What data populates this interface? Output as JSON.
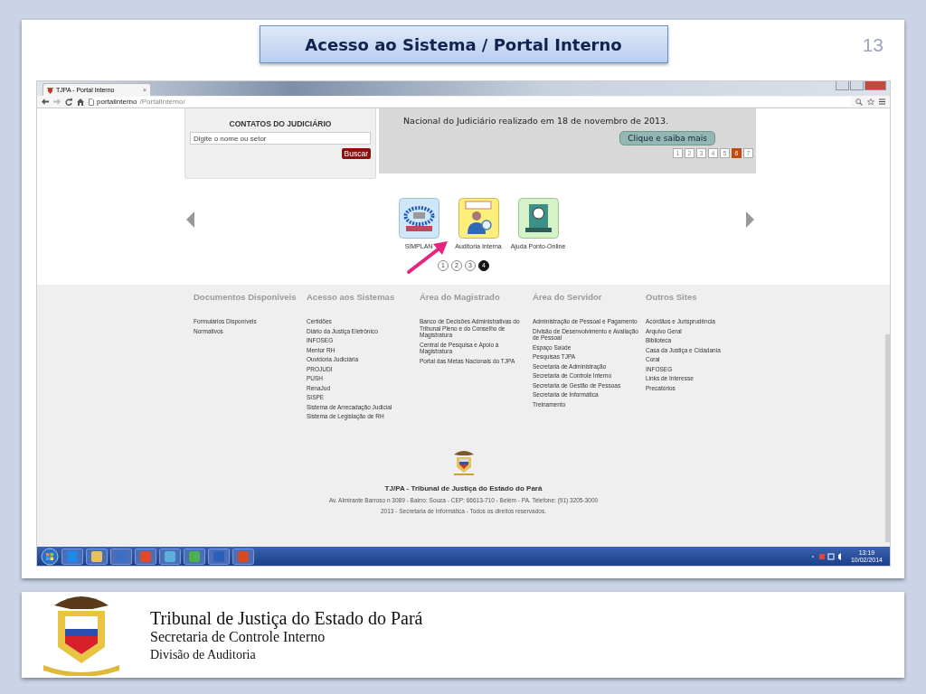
{
  "slide": {
    "title": "Acesso ao Sistema / Portal Interno",
    "page_number": "13"
  },
  "browser": {
    "tab_title": "TJPA - Portal Interno",
    "tab_close": "×",
    "url_host": "portalinterno",
    "url_path": "/PortalInterno/"
  },
  "contacts": {
    "title": "CONTATOS DO JUDICIÁRIO",
    "placeholder": "Digite o nome ou setor",
    "button": "Buscar"
  },
  "news": {
    "text": "Nacional do Judiciário realizado em 18 de novembro de 2013.",
    "button": "Clique e saiba mais",
    "pages": [
      {
        "label": "1",
        "selected": false
      },
      {
        "label": "2",
        "selected": false
      },
      {
        "label": "3",
        "selected": false
      },
      {
        "label": "4",
        "selected": false
      },
      {
        "label": "5",
        "selected": false
      },
      {
        "label": "6",
        "selected": true
      },
      {
        "label": "7",
        "selected": false
      }
    ]
  },
  "carousel": {
    "items": [
      {
        "label": "SIMPLAN",
        "kind": "network"
      },
      {
        "label": "Auditoria Interna",
        "kind": "audit"
      },
      {
        "label": "Ajuda Ponto-Online",
        "kind": "clock"
      }
    ],
    "dots": [
      {
        "label": "1",
        "selected": false
      },
      {
        "label": "2",
        "selected": false
      },
      {
        "label": "3",
        "selected": false
      },
      {
        "label": "4",
        "selected": true
      }
    ]
  },
  "footer": {
    "columns": [
      {
        "heading": "Documentos Disponíveis",
        "links": [
          "Formulários Disponíveis",
          "Normativos"
        ]
      },
      {
        "heading": "Acesso aos Sistemas",
        "links": [
          "Certidões",
          "Diário da Justiça Eletrônico",
          "INFOSEG",
          "Mentor RH",
          "Ouvidoria Judiciária",
          "PROJUDI",
          "PUSH",
          "RenaJud",
          "SISPE",
          "Sistema de Arrecadação Judicial",
          "Sistema de Legislação de RH"
        ]
      },
      {
        "heading": "Área do Magistrado",
        "links": [
          "Banco de Decisões Administrativas do Tribunal Pleno e do Conselho de Magistratura",
          "Central de Pesquisa e Apoio à Magistratura",
          "Portal das Metas Nacionais do TJPA"
        ]
      },
      {
        "heading": "Área do Servidor",
        "links": [
          "Administração de Pessoal e Pagamento",
          "Divisão de Desenvolvimento e Avaliação de Pessoal",
          "Espaço Saúde",
          "Pesquisas TJPA",
          "Secretaria de Administração",
          "Secretaria de Controle Interno",
          "Secretaria de Gestão de Pessoas",
          "Secretaria de Informática",
          "Treinamento"
        ]
      },
      {
        "heading": "Outros Sites",
        "links": [
          "Acórdãos e Jurisprudência",
          "Arquivo Geral",
          "Biblioteca",
          "Casa da Justiça e Cidadania",
          "Coral",
          "INFOSEG",
          "Links de Interesse",
          "Precatórios"
        ]
      }
    ],
    "org": "TJ/PA - Tribunal de Justiça do Estado do Pará",
    "address": "Av. Almirante Barroso n 3089 - Bairro: Souza - CEP: 66613-710 - Belém - PA. Telefone: (91) 3205-3000",
    "copyright": "2013 - Secretaria de Informática - Todos os direitos reservados."
  },
  "taskbar": {
    "time": "13:19",
    "date": "10/02/2014"
  },
  "caption": {
    "lines": [
      "Tribunal de Justiça do Estado do  Pará",
      "Secretaria de Controle Interno",
      "Divisão de Auditoria"
    ]
  }
}
